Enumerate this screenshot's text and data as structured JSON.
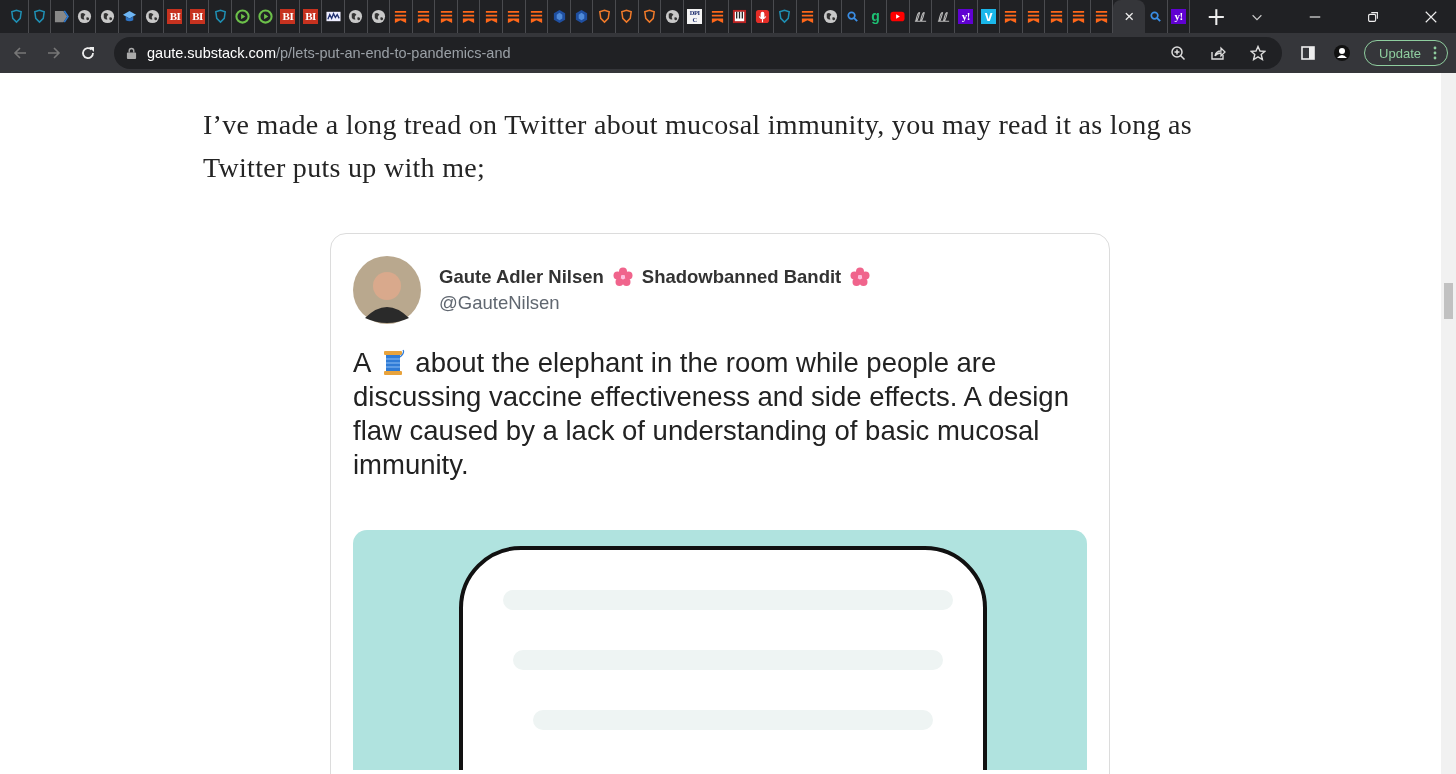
{
  "tabs": [
    {
      "kind": "shield",
      "color": "#1f8fb3",
      "selected": false
    },
    {
      "kind": "shield",
      "color": "#1f8fb3",
      "selected": false
    },
    {
      "kind": "tag",
      "selected": false
    },
    {
      "kind": "globe",
      "selected": false
    },
    {
      "kind": "globe",
      "selected": false
    },
    {
      "kind": "cap",
      "selected": false
    },
    {
      "kind": "globe",
      "selected": false
    },
    {
      "kind": "letters",
      "text": "BI",
      "color": "#c7321f",
      "selected": false
    },
    {
      "kind": "letters",
      "text": "BI",
      "color": "#c7321f",
      "selected": false
    },
    {
      "kind": "shield",
      "color": "#1f8fb3",
      "selected": false
    },
    {
      "kind": "play",
      "selected": false
    },
    {
      "kind": "play",
      "selected": false
    },
    {
      "kind": "letters",
      "text": "BI",
      "color": "#c7321f",
      "selected": false
    },
    {
      "kind": "letters",
      "text": "BI",
      "color": "#c7321f",
      "selected": false
    },
    {
      "kind": "ticker",
      "selected": false
    },
    {
      "kind": "globe",
      "selected": false
    },
    {
      "kind": "globe",
      "selected": false
    },
    {
      "kind": "bookmark",
      "selected": false
    },
    {
      "kind": "bookmark",
      "selected": false
    },
    {
      "kind": "bookmark",
      "selected": false
    },
    {
      "kind": "bookmark",
      "selected": false
    },
    {
      "kind": "bookmark",
      "selected": false
    },
    {
      "kind": "bookmark",
      "selected": false
    },
    {
      "kind": "bookmark",
      "selected": false
    },
    {
      "kind": "hex",
      "selected": false
    },
    {
      "kind": "hex",
      "selected": false
    },
    {
      "kind": "shield",
      "color": "#f07a2a",
      "selected": false
    },
    {
      "kind": "shield",
      "color": "#f07a2a",
      "selected": false
    },
    {
      "kind": "shield",
      "color": "#f07a2a",
      "selected": false
    },
    {
      "kind": "globe",
      "selected": false
    },
    {
      "kind": "letters",
      "text": "DPIC",
      "color": "#f4f4f4",
      "selected": false
    },
    {
      "kind": "bookmark",
      "selected": false
    },
    {
      "kind": "piano",
      "selected": false
    },
    {
      "kind": "mic",
      "selected": false
    },
    {
      "kind": "shield",
      "color": "#1f8fb3",
      "selected": false
    },
    {
      "kind": "bookmark",
      "selected": false
    },
    {
      "kind": "globe",
      "selected": false
    },
    {
      "kind": "search",
      "selected": false
    },
    {
      "kind": "letters",
      "text": "g",
      "color": "#202124",
      "selected": false
    },
    {
      "kind": "video",
      "selected": false
    },
    {
      "kind": "script",
      "selected": false
    },
    {
      "kind": "script",
      "selected": false
    },
    {
      "kind": "letters",
      "text": "y!",
      "color": "#6001d2",
      "selected": false
    },
    {
      "kind": "letters",
      "text": "v",
      "color": "#1ab7ea",
      "selected": false
    },
    {
      "kind": "bookmark",
      "selected": false
    },
    {
      "kind": "bookmark",
      "selected": false
    },
    {
      "kind": "bookmark",
      "selected": false
    },
    {
      "kind": "bookmark",
      "selected": false
    },
    {
      "kind": "bookmark",
      "selected": false
    },
    {
      "kind": "blank",
      "close": "×",
      "selected": true
    },
    {
      "kind": "search",
      "selected": false
    },
    {
      "kind": "letters",
      "text": "y!",
      "color": "#6001d2",
      "selected": false
    }
  ],
  "new_tab": "+",
  "address": {
    "host": "gaute.substack.com",
    "path": "/p/lets-put-an-end-to-pandemics-and"
  },
  "update_button": "Update",
  "article": {
    "paragraph": "I’ve made a long tread on Twitter about mucosal immunity, you may read it as long as Twitter puts up with me;"
  },
  "tweet": {
    "name": "Gaute Adler Nilsen",
    "name_suffix": "Shadowbanned Bandit",
    "handle": "@GauteNilsen",
    "text_before": "A",
    "text_after": "about the elephant in the room while people are",
    "text_rest": "discussing vaccine effectiveness and side effects. A design flaw caused by a lack of understanding of basic mucosal immunity."
  }
}
